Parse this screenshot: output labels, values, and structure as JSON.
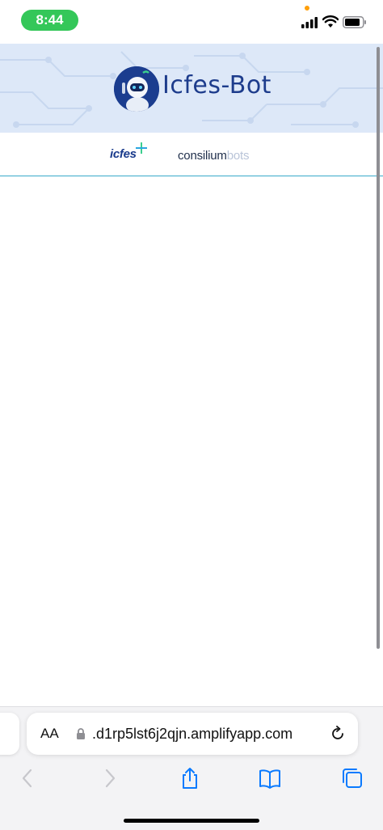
{
  "status_bar": {
    "time": "8:44",
    "icons": [
      "signal-icon",
      "wifi-icon",
      "battery-icon"
    ]
  },
  "header": {
    "app_title": "Icfes-Bot",
    "avatar_icon": "robot-icon"
  },
  "logos": {
    "icfes": "icfes",
    "consilium": "consilium",
    "bots": "bots"
  },
  "browser": {
    "text_size_label": "AA",
    "url": ".d1rp5lst6j2qjn.amplifyapp.com",
    "icons": {
      "lock": "lock-icon",
      "reload": "reload-icon",
      "back": "chevron-left-icon",
      "forward": "chevron-right-icon",
      "share": "share-icon",
      "bookmarks": "book-icon",
      "tabs": "tabs-icon"
    }
  },
  "colors": {
    "status_pill": "#34c759",
    "title_blue": "#1d3c8c",
    "banner_bg": "#dde8f8",
    "divider": "#39a9c9",
    "ios_blue": "#0a7aff"
  }
}
